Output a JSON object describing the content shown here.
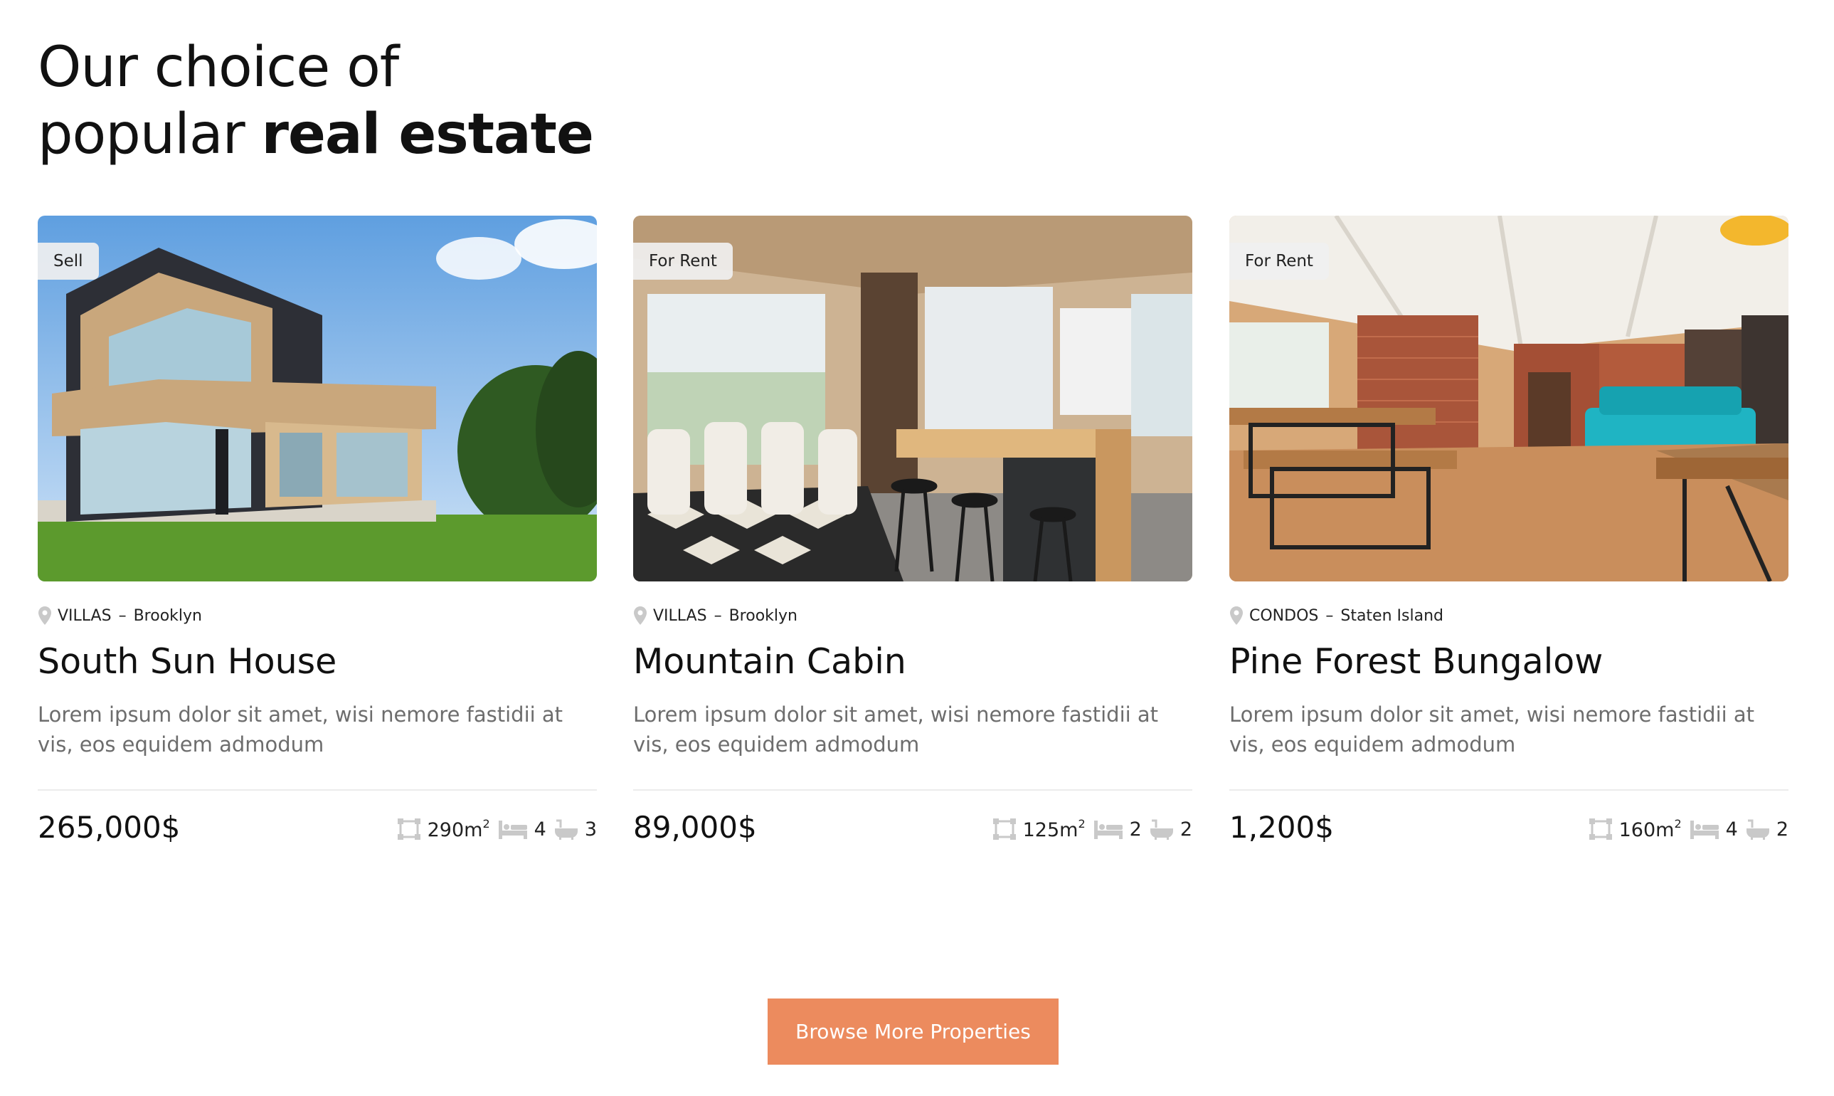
{
  "heading": {
    "line1": "Our choice of",
    "line2_regular": "popular ",
    "line2_bold": "real estate"
  },
  "properties": [
    {
      "badge": "Sell",
      "category": "VILLAS",
      "separator": "–",
      "location": "Brooklyn",
      "title": "South Sun House",
      "description": "Lorem ipsum dolor sit amet, wisi nemore fastidii at vis, eos equidem admodum",
      "price": "265,000$",
      "area": "290m",
      "area_unit_sup": "2",
      "bedrooms": "4",
      "bathrooms": "3",
      "image": "modern-villa-exterior"
    },
    {
      "badge": "For Rent",
      "category": "VILLAS",
      "separator": "–",
      "location": "Brooklyn",
      "title": "Mountain Cabin",
      "description": "Lorem ipsum dolor sit amet, wisi nemore fastidii at vis, eos equidem admodum",
      "price": "89,000$",
      "area": "125m",
      "area_unit_sup": "2",
      "bedrooms": "2",
      "bathrooms": "2",
      "image": "wooden-cabin-kitchen"
    },
    {
      "badge": "For Rent",
      "category": "CONDOS",
      "separator": "–",
      "location": "Staten Island",
      "title": "Pine Forest Bungalow",
      "description": "Lorem ipsum dolor sit amet, wisi nemore fastidii at vis, eos equidem admodum",
      "price": "1,200$",
      "area": "160m",
      "area_unit_sup": "2",
      "bedrooms": "4",
      "bathrooms": "2",
      "image": "loft-living-room"
    }
  ],
  "cta": {
    "label": "Browse More Properties"
  },
  "colors": {
    "accent": "#ec8b5e",
    "text": "#111111",
    "muted": "#6d6d6d",
    "icon": "#c9c9c9"
  },
  "icons": [
    "location-pin-icon",
    "area-icon",
    "bed-icon",
    "bath-icon"
  ]
}
